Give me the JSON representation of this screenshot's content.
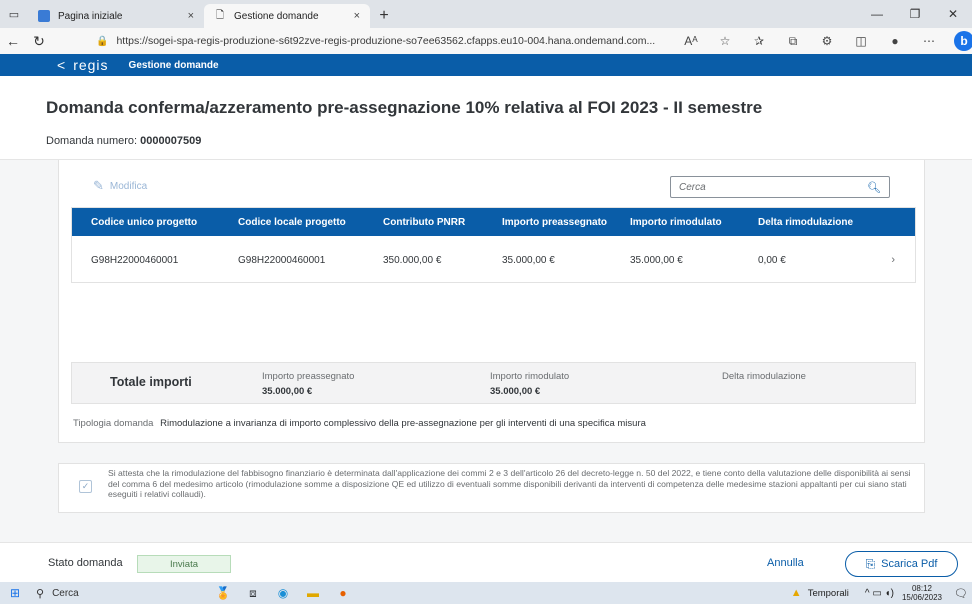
{
  "browser": {
    "tabs": [
      {
        "label": "Pagina iniziale",
        "active": false
      },
      {
        "label": "Gestione domande",
        "active": true
      }
    ],
    "close_glyph": "×",
    "newtab_glyph": "+",
    "url": "https://sogei-spa-regis-produzione-s6t92zve-regis-produzione-so7ee63562.cfapps.eu10-004.hana.ondemand.com...",
    "read_aloud": "Aᴬ"
  },
  "app": {
    "logo": "regis",
    "title": "Gestione domande"
  },
  "page": {
    "title": "Domanda conferma/azzeramento pre-assegnazione 10% relativa al FOI 2023 - II semestre",
    "request_label": "Domanda numero:",
    "request_number": "0000007509"
  },
  "toolbar": {
    "edit_label": "Modifica",
    "search_placeholder": "Cerca"
  },
  "table": {
    "columns": [
      "Codice unico progetto",
      "Codice locale progetto",
      "Contributo PNRR",
      "Importo preassegnato",
      "Importo rimodulato",
      "Delta rimodulazione"
    ],
    "rows": [
      {
        "cup": "G98H22000460001",
        "clp": "G98H22000460001",
        "contributo": "350.000,00 €",
        "preassegnato": "35.000,00 €",
        "rimodulato": "35.000,00 €",
        "delta": "0,00 €"
      }
    ]
  },
  "totals": {
    "label": "Totale importi",
    "preassegnato_label": "Importo preassegnato",
    "preassegnato_value": "35.000,00 €",
    "rimodulato_label": "Importo rimodulato",
    "rimodulato_value": "35.000,00 €",
    "delta_label": "Delta rimodulazione"
  },
  "tipologia": {
    "label": "Tipologia domanda",
    "value": "Rimodulazione a invarianza di importo complessivo della pre-assegnazione per gli interventi di una specifica misura"
  },
  "attestation": {
    "checked": true,
    "text": "Si attesta che la rimodulazione del fabbisogno finanziario è determinata dall'applicazione dei commi 2 e 3 dell'articolo 26 del decreto-legge n. 50 del 2022, e tiene conto della valutazione delle disponibilità ai sensi del comma 6 del medesimo articolo (rimodulazione somme a disposizione QE ed utilizzo di eventuali somme disponibili derivanti da interventi di competenza delle medesime stazioni appaltanti per cui siano stati eseguiti i relativi collaudi)."
  },
  "footer": {
    "status_label": "Stato domanda",
    "status_value": "Inviata",
    "cancel_label": "Annulla",
    "pdf_label": "Scarica Pdf"
  },
  "taskbar": {
    "search_label": "Cerca",
    "weather": "Temporali",
    "time": "08:12",
    "date": "15/06/2023"
  },
  "colors": {
    "brand": "#0a5da8",
    "status_bg": "#e8f5e9"
  }
}
